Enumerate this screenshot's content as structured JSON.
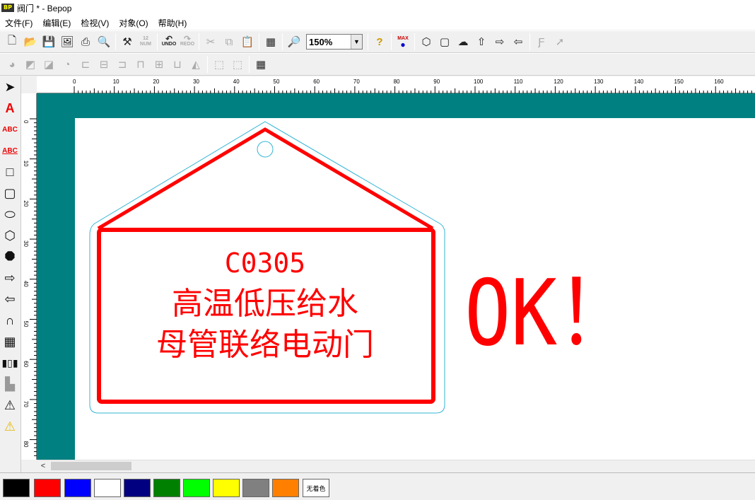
{
  "window": {
    "title": "阀门 * - Bepop",
    "app_icon_text": "Bepop"
  },
  "menu": [
    {
      "label": "文件(F)"
    },
    {
      "label": "编辑(E)"
    },
    {
      "label": "检视(V)"
    },
    {
      "label": "对象(O)"
    },
    {
      "label": "帮助(H)"
    }
  ],
  "toolbar": {
    "undo_label": "UNDO",
    "redo_label": "REDO",
    "num_label": "NUM",
    "zoom_value": "150%",
    "help_label": "?",
    "max_label": "MAX"
  },
  "ruler": {
    "top_labels": [
      "0",
      "10",
      "20",
      "30",
      "40",
      "50",
      "60",
      "70",
      "80",
      "90",
      "100",
      "110",
      "120",
      "130",
      "140",
      "150",
      "160",
      "17"
    ],
    "left_labels": [
      "0",
      "10",
      "20",
      "30",
      "40",
      "50",
      "60",
      "70",
      "80"
    ]
  },
  "tag": {
    "code": "C0305",
    "line1": "高温低压给水",
    "line2": "母管联络电动门",
    "stamp": "OK！",
    "color": "#ff0000",
    "outline_color": "#33b5d6"
  },
  "palette": {
    "colors": [
      "#000000",
      "#ff0000",
      "#0000ff",
      "#ffffff",
      "#000080",
      "#008000",
      "#00ff00",
      "#ffff00",
      "#808080",
      "#ff8000"
    ],
    "no_color_label": "无着色"
  }
}
